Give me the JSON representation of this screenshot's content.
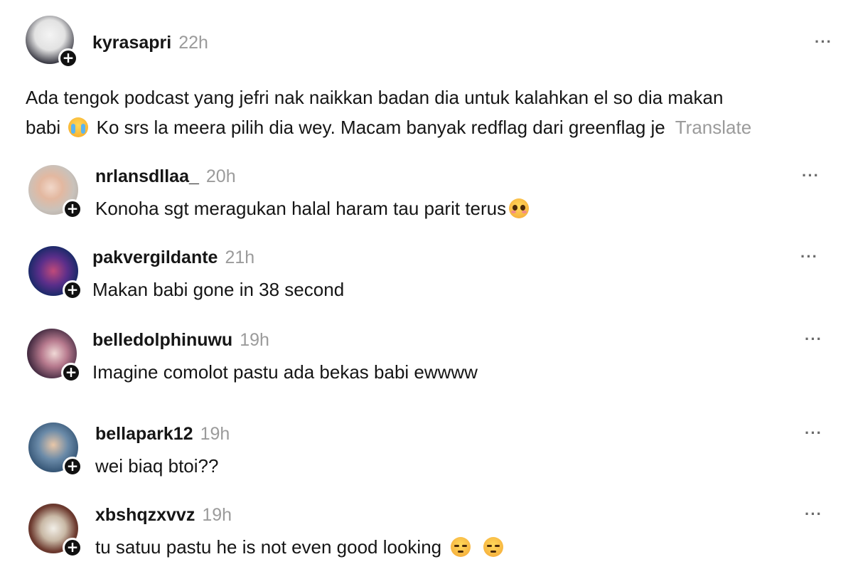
{
  "post": {
    "username": "kyrasapri",
    "time": "22h",
    "text_line1": "Ada tengok podcast yang jefri nak naikkan badan dia untuk kalahkan el so dia makan",
    "text_line2_a": "babi",
    "text_line2_b": "Ko srs la meera pilih dia wey. Macam banyak redflag dari greenflag je",
    "translate_label": "Translate",
    "more_label": "···"
  },
  "comments": [
    {
      "username": "nrlansdllaa_",
      "time": "20h",
      "text": "Konoha sgt meragukan halal haram tau parit terus",
      "more_label": "···"
    },
    {
      "username": "pakvergildante",
      "time": "21h",
      "text": "Makan babi gone in 38 second",
      "more_label": "···"
    },
    {
      "username": "belledolphinuwu",
      "time": "19h",
      "text": "Imagine comolot pastu ada bekas babi ewwww",
      "more_label": "···"
    },
    {
      "username": "bellapark12",
      "time": "19h",
      "text": "wei biaq btoi??",
      "more_label": "···"
    },
    {
      "username": "xbshqzxvvz",
      "time": "19h",
      "text": "tu satuu pastu he is not even good looking",
      "more_label": "···"
    }
  ],
  "follow_icon_label": "+",
  "colors": {
    "text": "#151515",
    "muted": "#9b9b9b",
    "follow_badge": "#111111"
  },
  "icons": [
    "plus-icon",
    "more-icon",
    "crying-emoji-icon",
    "pleading-emoji-icon",
    "pensive-emoji-icon"
  ]
}
